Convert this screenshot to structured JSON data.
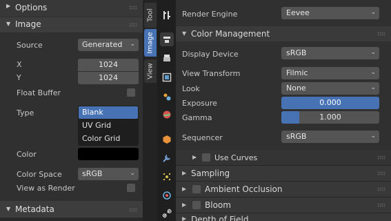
{
  "left_panel": {
    "options_label": "Options",
    "image_label": "Image",
    "source_label": "Source",
    "source_value": "Generated",
    "x_label": "X",
    "x_value": "1024",
    "y_label": "Y",
    "y_value": "1024",
    "float_buffer_label": "Float Buffer",
    "type_label": "Type",
    "type_options": [
      "Blank",
      "UV Grid",
      "Color Grid"
    ],
    "type_selected": "Blank",
    "color_label": "Color",
    "color_value": "#000000",
    "color_space_label": "Color Space",
    "color_space_value": "sRGB",
    "view_as_render_label": "View as Render",
    "metadata_label": "Metadata"
  },
  "tabs": [
    "Tool",
    "Image",
    "View"
  ],
  "active_tab": "Image",
  "property_icons": [
    "tool-settings-icon",
    "render-icon",
    "output-icon",
    "view-layer-icon",
    "scene-icon",
    "world-icon",
    "object-icon",
    "modifier-icon",
    "particles-icon",
    "physics-icon",
    "constraints-icon"
  ],
  "right_panel": {
    "render_engine_label": "Render Engine",
    "render_engine_value": "Eevee",
    "color_management_label": "Color Management",
    "display_device_label": "Display Device",
    "display_device_value": "sRGB",
    "view_transform_label": "View Transform",
    "view_transform_value": "Filmic",
    "look_label": "Look",
    "look_value": "None",
    "exposure_label": "Exposure",
    "exposure_value": "0.000",
    "gamma_label": "Gamma",
    "gamma_value": "1.000",
    "sequencer_label": "Sequencer",
    "sequencer_value": "sRGB",
    "use_curves_label": "Use Curves",
    "sampling_label": "Sampling",
    "ambient_occlusion_label": "Ambient Occlusion",
    "bloom_label": "Bloom",
    "depth_of_field_label": "Depth of Field"
  },
  "colors": {
    "accent": "#4772b3",
    "panel_bg": "#303030",
    "field_bg": "#545454",
    "header_bg": "#3d3d3d"
  }
}
